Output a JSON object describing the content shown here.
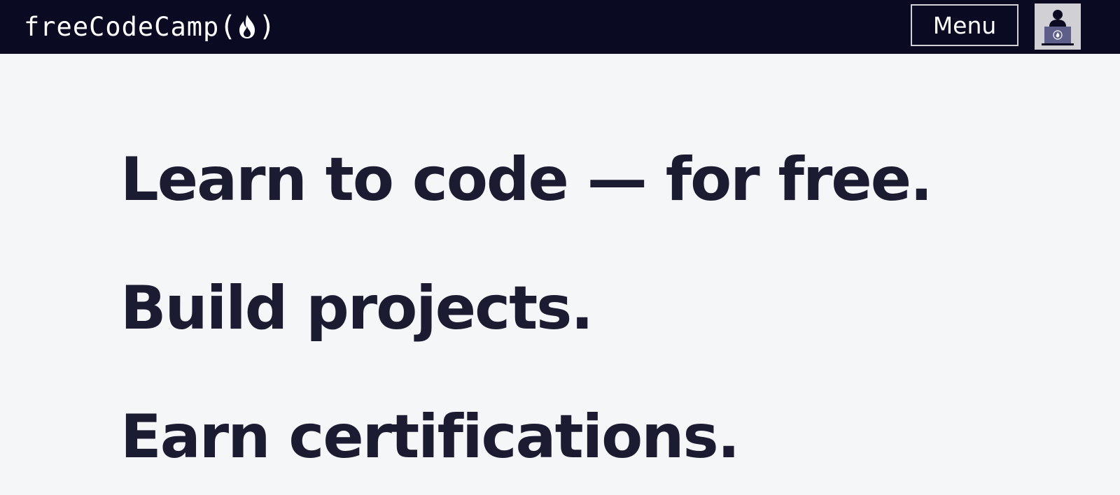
{
  "header": {
    "logo_text": "freeCodeCamp",
    "logo_open_paren": "(",
    "logo_close_paren": ")",
    "menu_label": "Menu",
    "avatar_icon": "user-avatar-icon",
    "logo_icon": "flame-icon"
  },
  "hero": {
    "line1": "Learn to code — for free.",
    "line2": "Build projects.",
    "line3": "Earn certifications."
  },
  "colors": {
    "navbar_bg": "#0a0a23",
    "page_bg": "#f5f6f7",
    "heading_text": "#1b1b32",
    "menu_border": "#d0d0d5",
    "avatar_bg": "#d0d0d5",
    "avatar_figure": "#0a0a23",
    "avatar_laptop": "#5e5e8a"
  }
}
